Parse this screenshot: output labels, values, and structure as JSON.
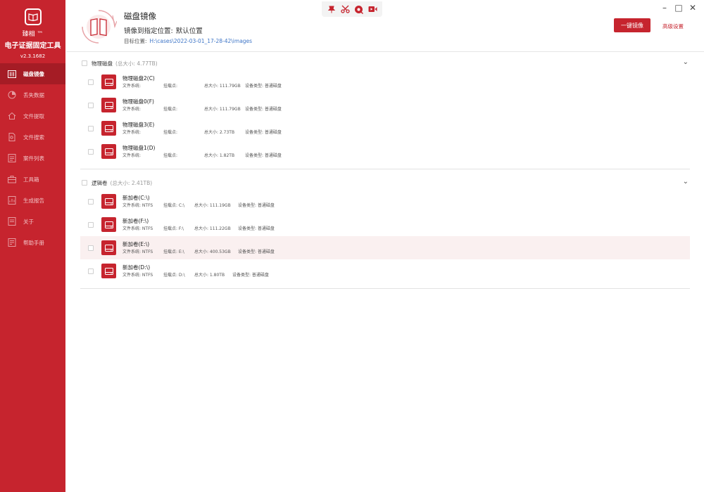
{
  "app": {
    "name": "臻相 ™",
    "title": "电子证据固定工具",
    "version": "v2.3.1682"
  },
  "nav": [
    {
      "label": "磁盘镜像",
      "icon": "disk-image-icon",
      "active": true
    },
    {
      "label": "丢失数据",
      "icon": "lost-data-icon",
      "active": false
    },
    {
      "label": "文件提取",
      "icon": "file-extract-icon",
      "active": false
    },
    {
      "label": "文件搜索",
      "icon": "file-search-icon",
      "active": false
    },
    {
      "label": "案件列表",
      "icon": "case-list-icon",
      "active": false
    },
    {
      "label": "工具箱",
      "icon": "toolbox-icon",
      "active": false
    },
    {
      "label": "生成报告",
      "icon": "report-icon",
      "active": false
    },
    {
      "label": "关于",
      "icon": "about-icon",
      "active": false
    },
    {
      "label": "帮助手册",
      "icon": "help-manual-icon",
      "active": false
    }
  ],
  "toolbar": {
    "icons": [
      "pin-icon",
      "scissors-icon",
      "camera-icon",
      "record-icon"
    ]
  },
  "header": {
    "title": "磁盘镜像",
    "subtitle_prefix": "镜像到指定位置:",
    "subtitle_value": "默认位置",
    "path_label": "目标位置:",
    "path_value": "H:\\cases\\2022-03-01_17-28-42\\images",
    "primary_button": "一键镜像",
    "link_button": "高级设置"
  },
  "colors": {
    "brand": "#c6242e",
    "brand_dark": "#a51c25",
    "link": "#3f76c7"
  },
  "physical": {
    "title": "物理磁盘",
    "total": "(总大小: 4.77TB)",
    "items": [
      {
        "name": "物理磁盘2(C)",
        "fs": "文件系统:",
        "mount": "挂载点:",
        "size": "总大小: 111.79GB",
        "type": "设备类型: 普通磁盘"
      },
      {
        "name": "物理磁盘0(F)",
        "fs": "文件系统:",
        "mount": "挂载点:",
        "size": "总大小: 111.79GB",
        "type": "设备类型: 普通磁盘"
      },
      {
        "name": "物理磁盘3(E)",
        "fs": "文件系统:",
        "mount": "挂载点:",
        "size": "总大小: 2.73TB",
        "type": "设备类型: 普通磁盘"
      },
      {
        "name": "物理磁盘1(D)",
        "fs": "文件系统:",
        "mount": "挂载点:",
        "size": "总大小: 1.82TB",
        "type": "设备类型: 普通磁盘"
      }
    ]
  },
  "logical": {
    "title": "逻辑卷",
    "total": "(总大小: 2.41TB)",
    "items": [
      {
        "name": "新加卷(C:\\)",
        "fs": "文件系统: NTFS",
        "mount": "挂载点: C:\\",
        "size": "总大小: 111.19GB",
        "type": "设备类型: 普通磁盘"
      },
      {
        "name": "新加卷(F:\\)",
        "fs": "文件系统: NTFS",
        "mount": "挂载点: F:\\",
        "size": "总大小: 111.22GB",
        "type": "设备类型: 普通磁盘"
      },
      {
        "name": "新加卷(E:\\)",
        "fs": "文件系统: NTFS",
        "mount": "挂载点: E:\\",
        "size": "总大小: 400.53GB",
        "type": "设备类型: 普通磁盘"
      },
      {
        "name": "新加卷(D:\\)",
        "fs": "文件系统: NTFS",
        "mount": "挂载点: D:\\",
        "size": "总大小: 1.80TB",
        "type": "设备类型: 普通磁盘"
      }
    ]
  }
}
